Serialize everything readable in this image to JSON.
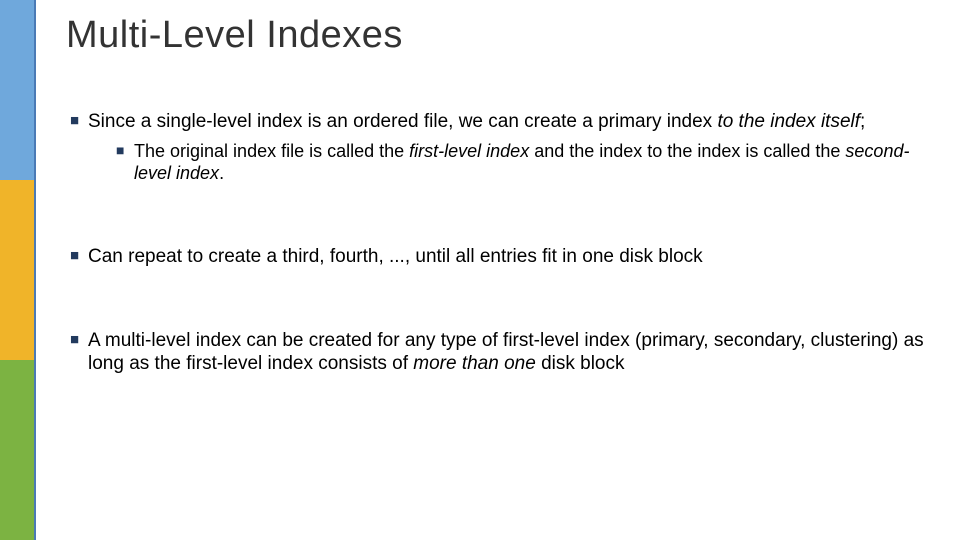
{
  "title": "Multi-Level Indexes",
  "bullets": {
    "b1_pre": "Since a single-level index is an ordered file, we can create a primary index ",
    "b1_ital": "to the index itself",
    "b1_post": ";",
    "b1a_pre": "The original index file is called the ",
    "b1a_i1": "first-level index",
    "b1a_mid": " and the index to the index is called the ",
    "b1a_i2": "second-level index",
    "b1a_post": ".",
    "b2": "Can repeat to create a third, fourth, ..., until all entries fit in one disk block",
    "b3_pre": "A multi-level index can be created for any type of first-level index (primary, secondary, clustering) as long as the first-level index consists of ",
    "b3_ital": "more than one",
    "b3_post": " disk block"
  }
}
